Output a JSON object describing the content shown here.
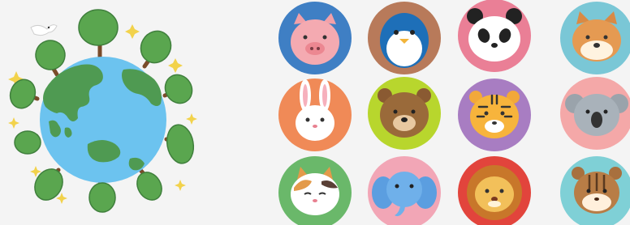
{
  "scene": {
    "left_panel": {
      "subject": "earth-globe-with-trees",
      "colors": {
        "ocean": "#6cc3ef",
        "land": "#4f9a52",
        "tree": "#5aa64f",
        "trunk": "#7a4b2a",
        "sparkle": "#f2d24b"
      }
    },
    "icon_grid": {
      "rows": 3,
      "columns": 4,
      "tiles": [
        {
          "icon": "pig-icon",
          "background": "#3f7fc4"
        },
        {
          "icon": "penguin-icon",
          "background": "#b87a5a"
        },
        {
          "icon": "panda-icon",
          "background": "#ea7f96"
        },
        {
          "icon": "shiba-dog-icon",
          "background": "#7ac7d6"
        },
        {
          "icon": "rabbit-icon",
          "background": "#f08a57"
        },
        {
          "icon": "bear-icon",
          "background": "#b8d62d"
        },
        {
          "icon": "tiger-icon",
          "background": "#a87dc2"
        },
        {
          "icon": "koala-icon",
          "background": "#f4a8a8"
        },
        {
          "icon": "calico-cat-icon",
          "background": "#6ab86a"
        },
        {
          "icon": "elephant-icon",
          "background": "#f2a6b6"
        },
        {
          "icon": "lion-icon",
          "background": "#e2443c"
        },
        {
          "icon": "chipmunk-icon",
          "background": "#7fd0d6"
        }
      ]
    }
  }
}
